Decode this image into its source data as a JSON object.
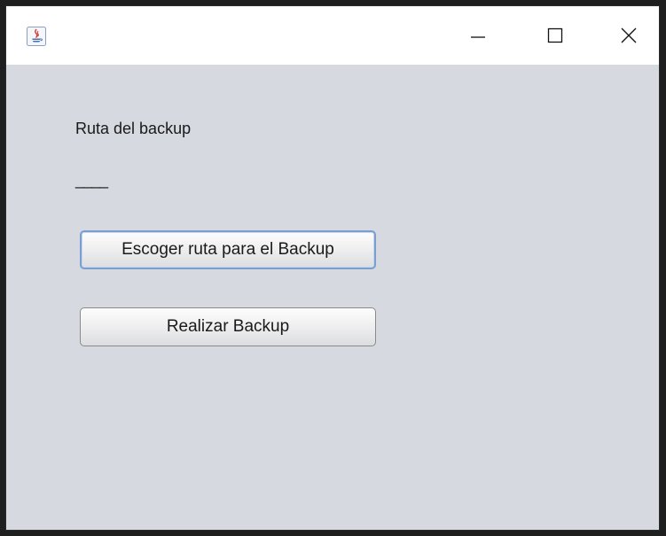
{
  "window": {
    "title": "",
    "icon": "java-coffee-cup-icon",
    "controls": {
      "minimize_icon": "minimize-icon",
      "maximize_icon": "maximize-icon",
      "close_icon": "close-icon"
    }
  },
  "main": {
    "path_label": "Ruta del backup",
    "path_value": "____",
    "choose_button_label": "Escoger ruta para el Backup",
    "backup_button_label": "Realizar Backup"
  },
  "colors": {
    "content_background": "#d6d9e0",
    "focus_border": "#7a9ed0"
  }
}
